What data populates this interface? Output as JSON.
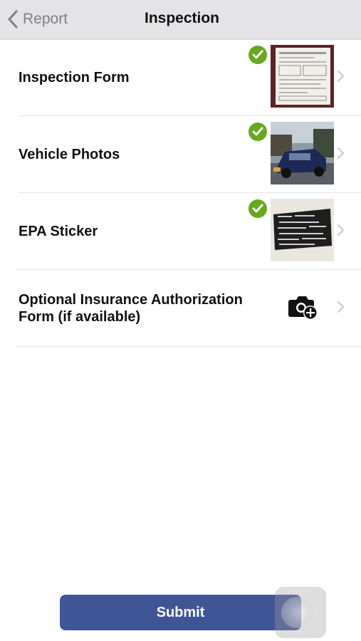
{
  "nav": {
    "back_label": "Report",
    "title": "Inspection"
  },
  "rows": [
    {
      "label": "Inspection Form",
      "completed": true,
      "thumbnail": "inspection-form-photo"
    },
    {
      "label": "Vehicle Photos",
      "completed": true,
      "thumbnail": "vehicle-photo"
    },
    {
      "label": "EPA Sticker",
      "completed": true,
      "thumbnail": "epa-sticker-photo"
    },
    {
      "label": "Optional Insurance Authorization Form (if available)",
      "completed": false,
      "thumbnail": "camera-add-icon"
    }
  ],
  "submit_label": "Submit",
  "colors": {
    "navbar_bg": "#e4e4e6",
    "check_green": "#67a81e",
    "submit_bg": "#3f5596"
  }
}
